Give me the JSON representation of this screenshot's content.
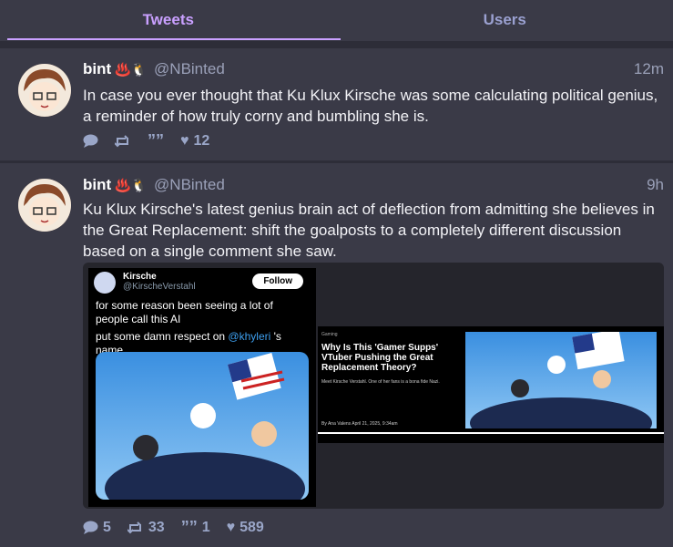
{
  "tabs": [
    {
      "label": "Tweets",
      "active": true
    },
    {
      "label": "Users",
      "active": false
    }
  ],
  "tweets": [
    {
      "name": "bint",
      "badges": "♨️🐧",
      "handle": "@NBinted",
      "time": "12m",
      "text": "In case you ever thought that Ku Klux Kirsche was some calculating political genius, a reminder of how truly corny and bumbling she is.",
      "replies": "",
      "retweets": "",
      "quotes": "",
      "likes": "12"
    },
    {
      "name": "bint",
      "badges": "♨️🐧",
      "handle": "@NBinted",
      "time": "9h",
      "text": "Ku Klux Kirsche's latest genius brain act of deflection from admitting she believes in the Great Replacement: shift the goalposts to a completely different discussion based on a single comment she saw.",
      "replies": "5",
      "retweets": "33",
      "quotes": "1",
      "likes": "589",
      "embed": {
        "author": "Kirsche",
        "author_handle": "@KirscheVerstahl",
        "follow": "Follow",
        "text_line1": "for some reason been seeing a lot of people call this AI",
        "text_line2_pre": "put some damn respect on ",
        "mention": "@khyleri",
        "text_line2_post": " 's name"
      },
      "article": {
        "category": "Gaming",
        "headline": "Why Is This 'Gamer Supps' VTuber Pushing the Great Replacement Theory?",
        "subhead": "Meet Kirsche Verstahl. One of her fans is a bona fide Nazi.",
        "byline": "By Ana Valens   April 21, 2025, 9:34am"
      }
    }
  ],
  "colors": {
    "accent": "#c9a0ff",
    "background": "#3a3a47",
    "action": "#9aa6c8"
  }
}
